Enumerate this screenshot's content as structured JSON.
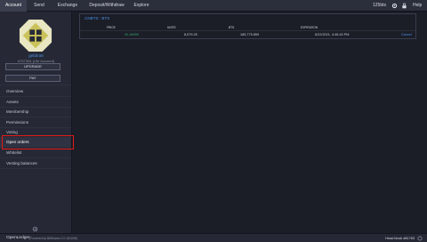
{
  "topbar": {
    "nav": [
      "Account",
      "Send",
      "Exchange",
      "Deposit/Withdraw",
      "Explore"
    ],
    "active_index": 0,
    "balance": "125bts",
    "help": "Help"
  },
  "sidebar": {
    "account_name": "gebbra8",
    "account_sub": "#757304 (Life Account)",
    "buttons": [
      "UPGRADE",
      "PAY"
    ],
    "menu": [
      "Overview",
      "Assets",
      "Membership",
      "Permissions",
      "Voting",
      "Open orders",
      "Whitelist",
      "Vesting balances"
    ],
    "selected_index": 5
  },
  "panel": {
    "title": "CNBTS : BTS",
    "columns": [
      "PRICE",
      "UNITS",
      "BTS",
      "EXPIRATION"
    ],
    "row": {
      "price": "20.18999",
      "units": "8,579.25",
      "bts": "185,775.859",
      "expiration": "6/22/2021, 4:46:43 PM",
      "action": "Cancel"
    }
  },
  "bottombar": {
    "brand": "OpenLedger",
    "powered": "(Powered by BitShares 2.0 161006)",
    "headblock": "Head block #81763"
  },
  "colors": {
    "accent_blue": "#4a90e2",
    "highlight_red": "#e21a1a",
    "green": "#3aa76d"
  }
}
